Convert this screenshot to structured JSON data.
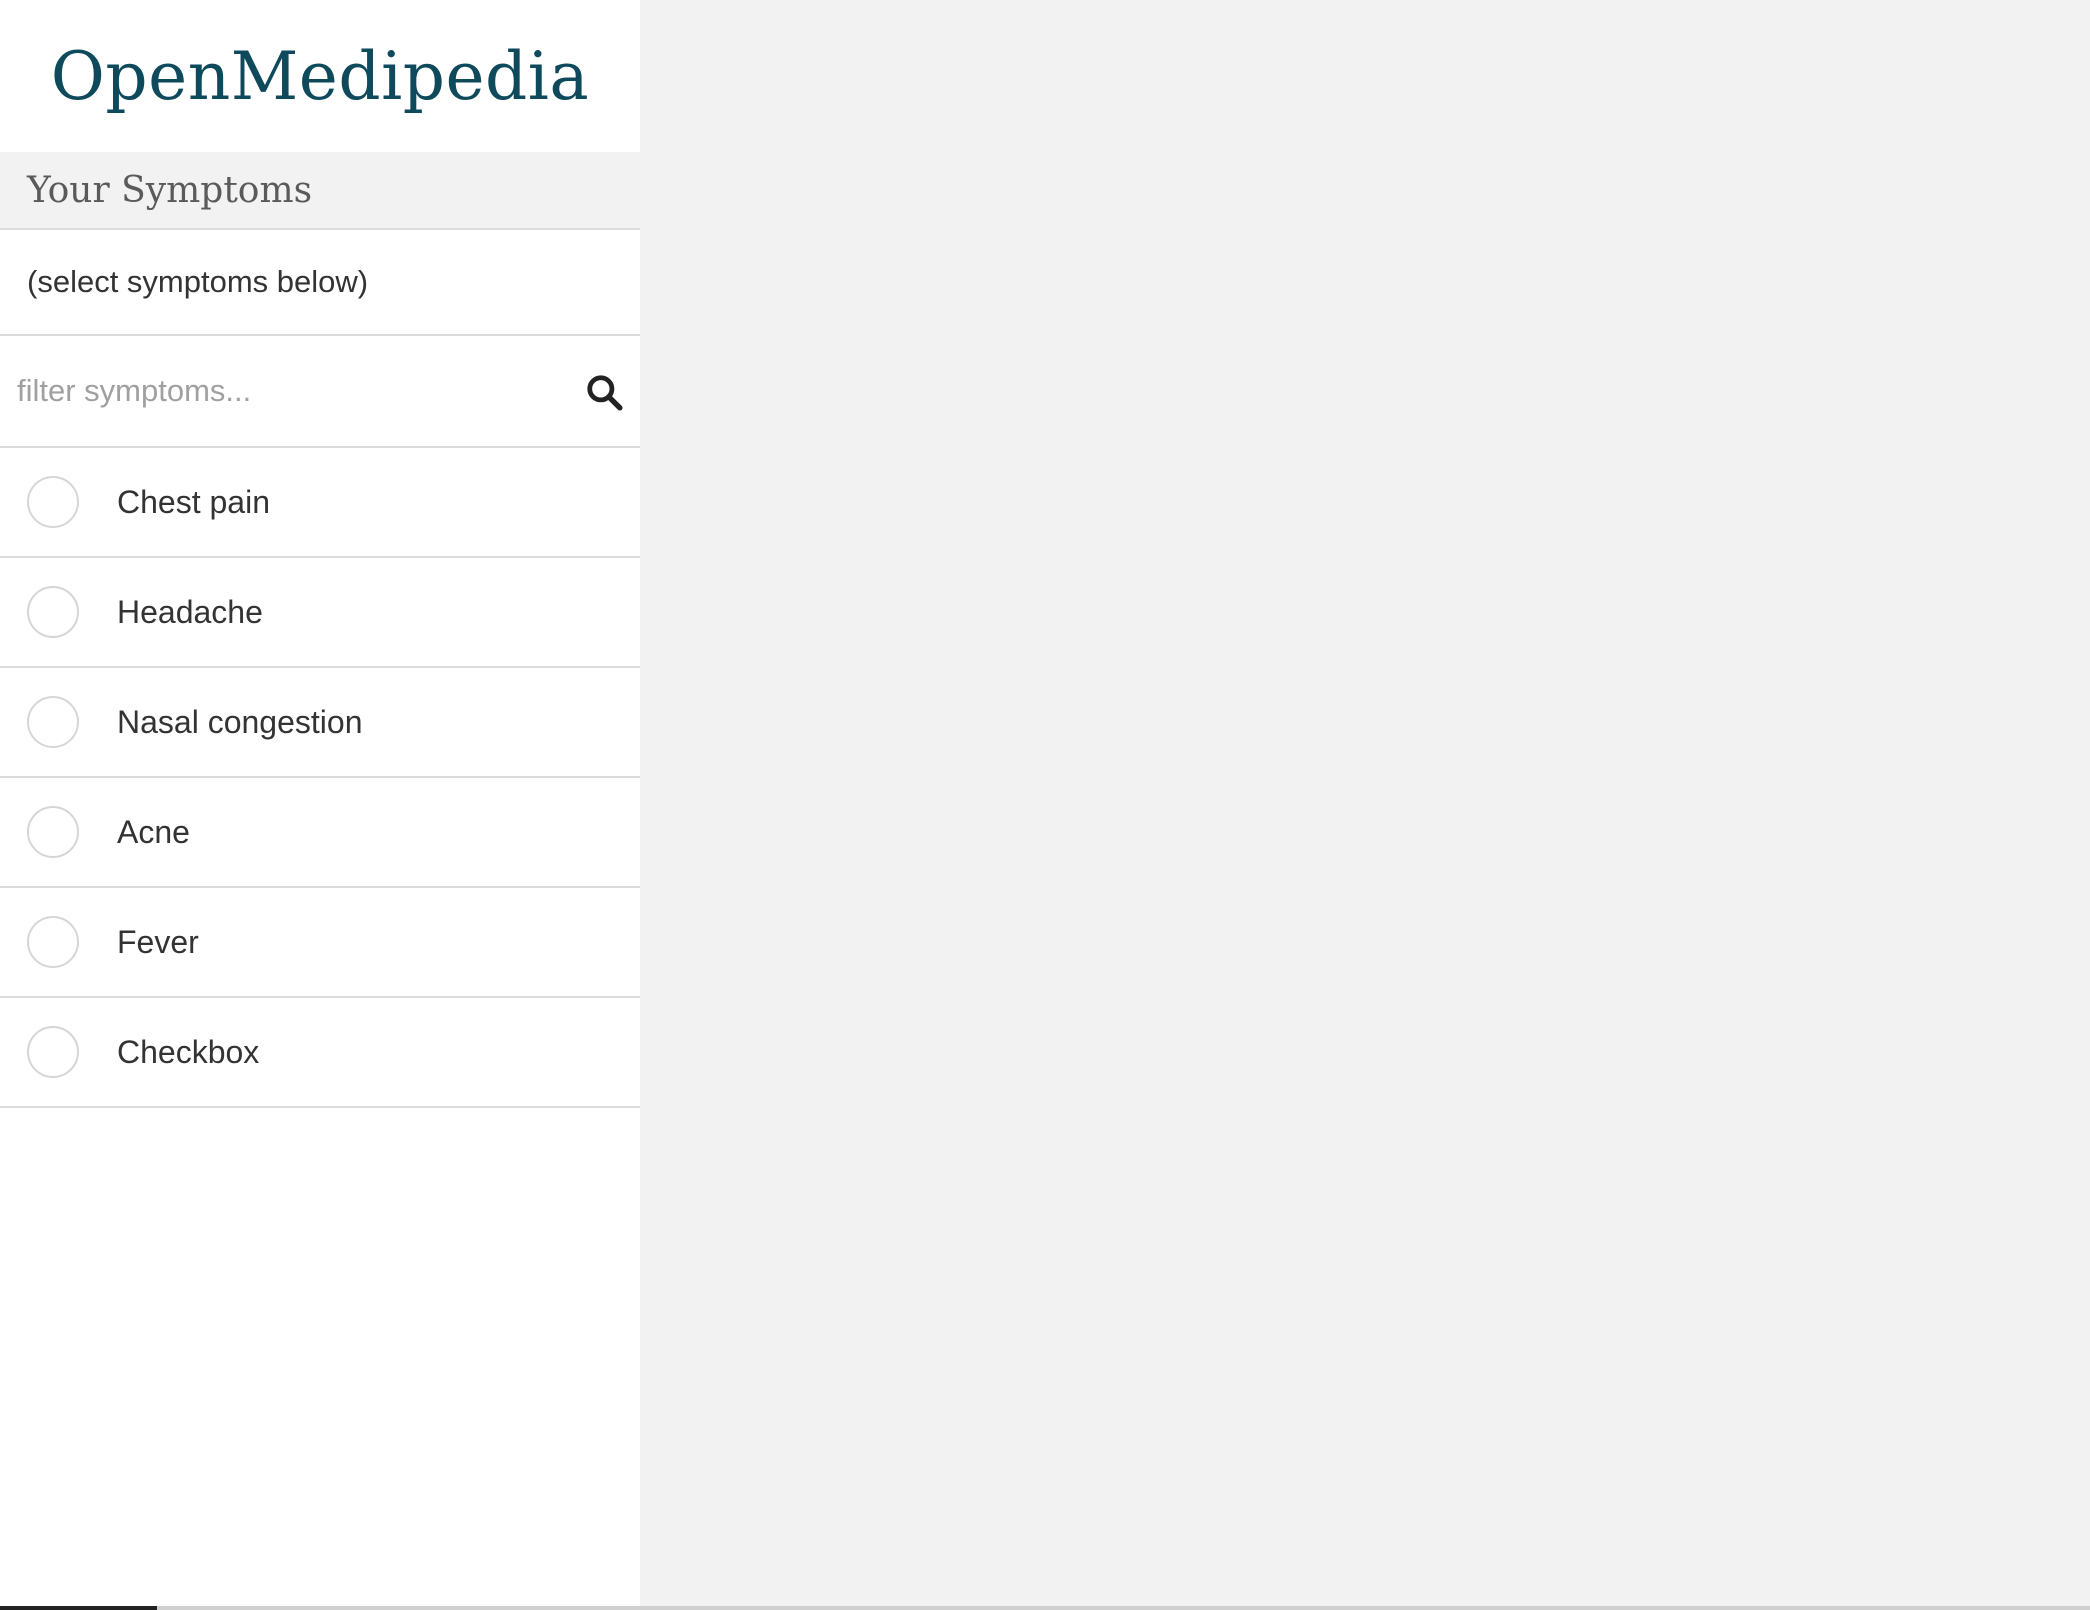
{
  "app": {
    "brand": "OpenMedipedia"
  },
  "sidebar": {
    "section_title": "Your Symptoms",
    "selected_summary": "(select symptoms below)",
    "filter": {
      "placeholder": "filter symptoms...",
      "value": "",
      "icon": "search-icon"
    },
    "symptoms": [
      {
        "label": "Chest pain",
        "selected": false
      },
      {
        "label": "Headache",
        "selected": false
      },
      {
        "label": "Nasal congestion",
        "selected": false
      },
      {
        "label": "Acne",
        "selected": false
      },
      {
        "label": "Fever",
        "selected": false
      },
      {
        "label": "Checkbox",
        "selected": false
      }
    ]
  },
  "colors": {
    "brand": "#0e4a5c",
    "sidebar_bg": "#ffffff",
    "page_bg": "#f2f2f2",
    "divider": "#dcdcdc",
    "text": "#333333",
    "placeholder": "#a0a0a0"
  },
  "bottom_bar": {
    "progress_fraction": 0.075
  }
}
